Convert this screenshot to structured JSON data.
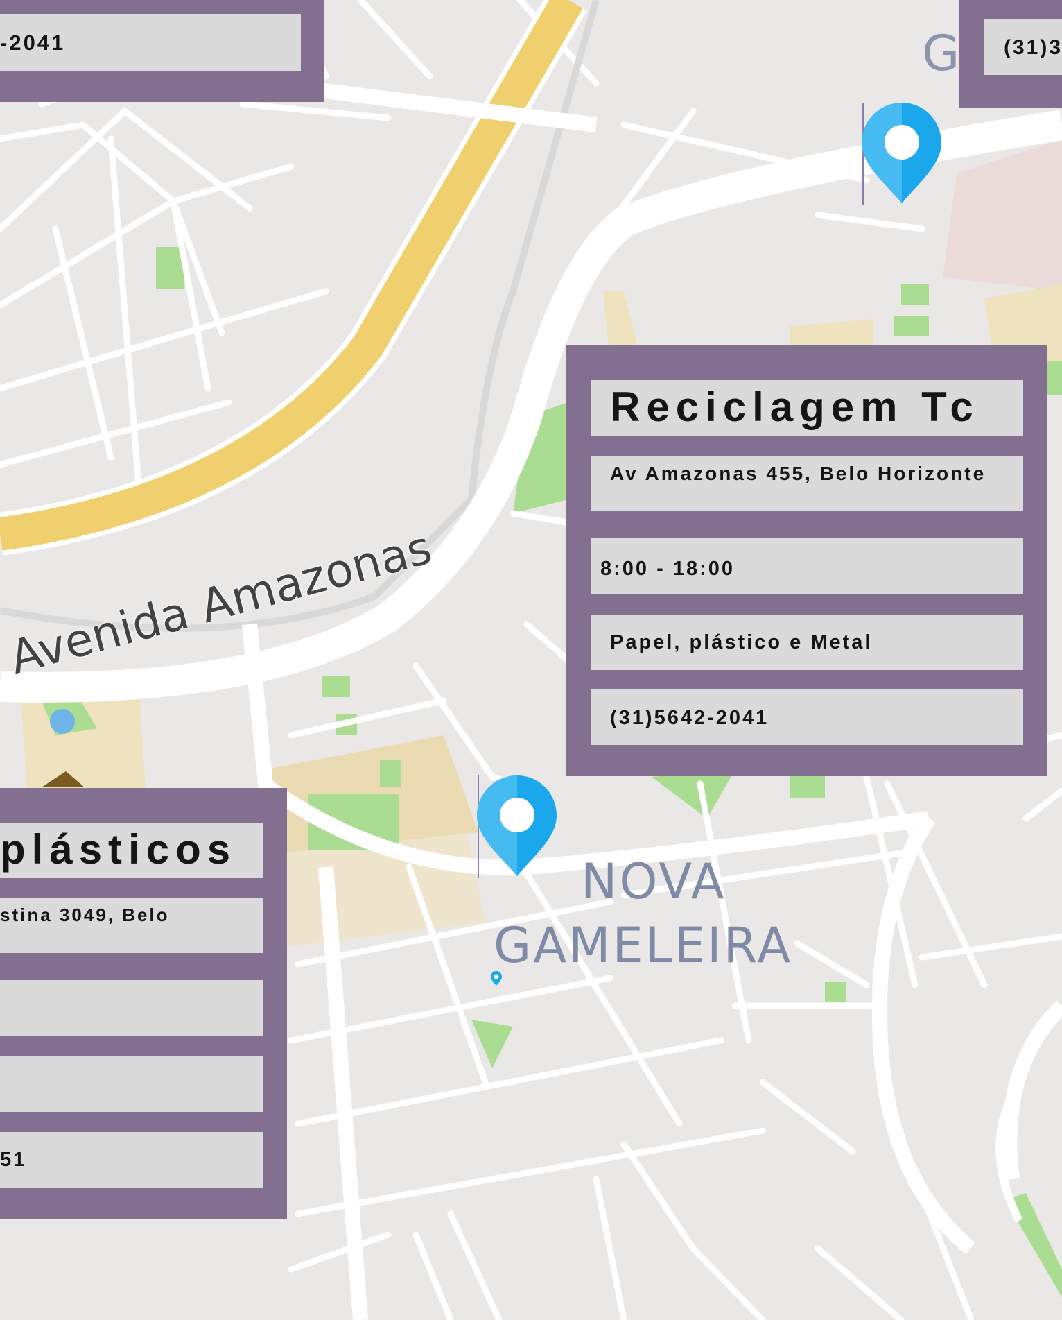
{
  "map": {
    "neighborhood_line1": "NOVA",
    "neighborhood_line2": "GAMELEIRA",
    "street_name": "Avenida Amazonas",
    "partial_label": "G"
  },
  "cards": {
    "center": {
      "title": "Reciclagem Tc",
      "address": "Av Amazonas 455, Belo Horizonte",
      "hours": "8:00 - 18:00",
      "materials": "Papel, plástico e Metal",
      "phone": "(31)5642-2041"
    },
    "left_bottom": {
      "title": "plásticos",
      "address": "stina 3049, Belo",
      "phone": "51"
    },
    "top_left": {
      "phone": "-2041"
    },
    "top_right": {
      "phone": "(31)3"
    }
  },
  "colors": {
    "card_frame": "#837091",
    "field_bg": "#dadada",
    "pin": "#1aa7ec",
    "highway": "#f0cf6e",
    "park": "#aadc91",
    "map_bg": "#e9e8e6"
  },
  "icons": [
    "location-pin-icon",
    "small-location-pin-icon",
    "water-feature",
    "pyramid-landmark-icon"
  ]
}
